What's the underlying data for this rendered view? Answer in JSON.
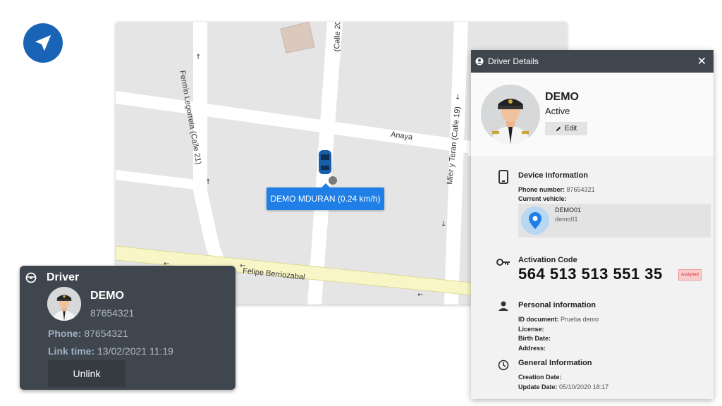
{
  "map": {
    "streets": {
      "calle20": "(Calle 20",
      "fermin": "Fermin Legorreta (Calle 21)",
      "anaya": "Anaya",
      "mier": "Mier y Teran (Calle 19)",
      "felipe": "Felipe Berriozabal"
    },
    "car_popup": "DEMO MDURAN (0.24 km/h)"
  },
  "details": {
    "header_title": "Driver Details",
    "name": "DEMO",
    "status": "Active",
    "edit_label": "Edit",
    "device": {
      "title": "Device Information",
      "phone_label": "Phone number:",
      "phone_value": "87654321",
      "vehicle_label": "Current vehicle:",
      "vehicle_name": "DEMO01",
      "vehicle_sub": "demo01"
    },
    "activation": {
      "title": "Activation Code",
      "code": "564 513 513 551 35",
      "badge": "Assigned"
    },
    "personal": {
      "title": "Personal information",
      "id_label": "ID document:",
      "id_value": "Prueba demo",
      "license_label": "License:",
      "birth_label": "Birth Date:",
      "address_label": "Address:"
    },
    "general": {
      "title": "General Information",
      "creation_label": "Creation Date:",
      "update_label": "Update Date:",
      "update_value": "05/10/2020 18:17"
    }
  },
  "driver_card": {
    "title": "Driver",
    "name": "DEMO",
    "phone_top": "87654321",
    "phone_label": "Phone:",
    "phone_value": "87654321",
    "link_label": "Link time:",
    "link_value": "13/02/2021 11:19",
    "unlink_label": "Unlink"
  },
  "colors": {
    "accent_blue": "#1f7fe6",
    "panel_dark": "#3f464d",
    "assigned_badge": "#f8cccc"
  }
}
